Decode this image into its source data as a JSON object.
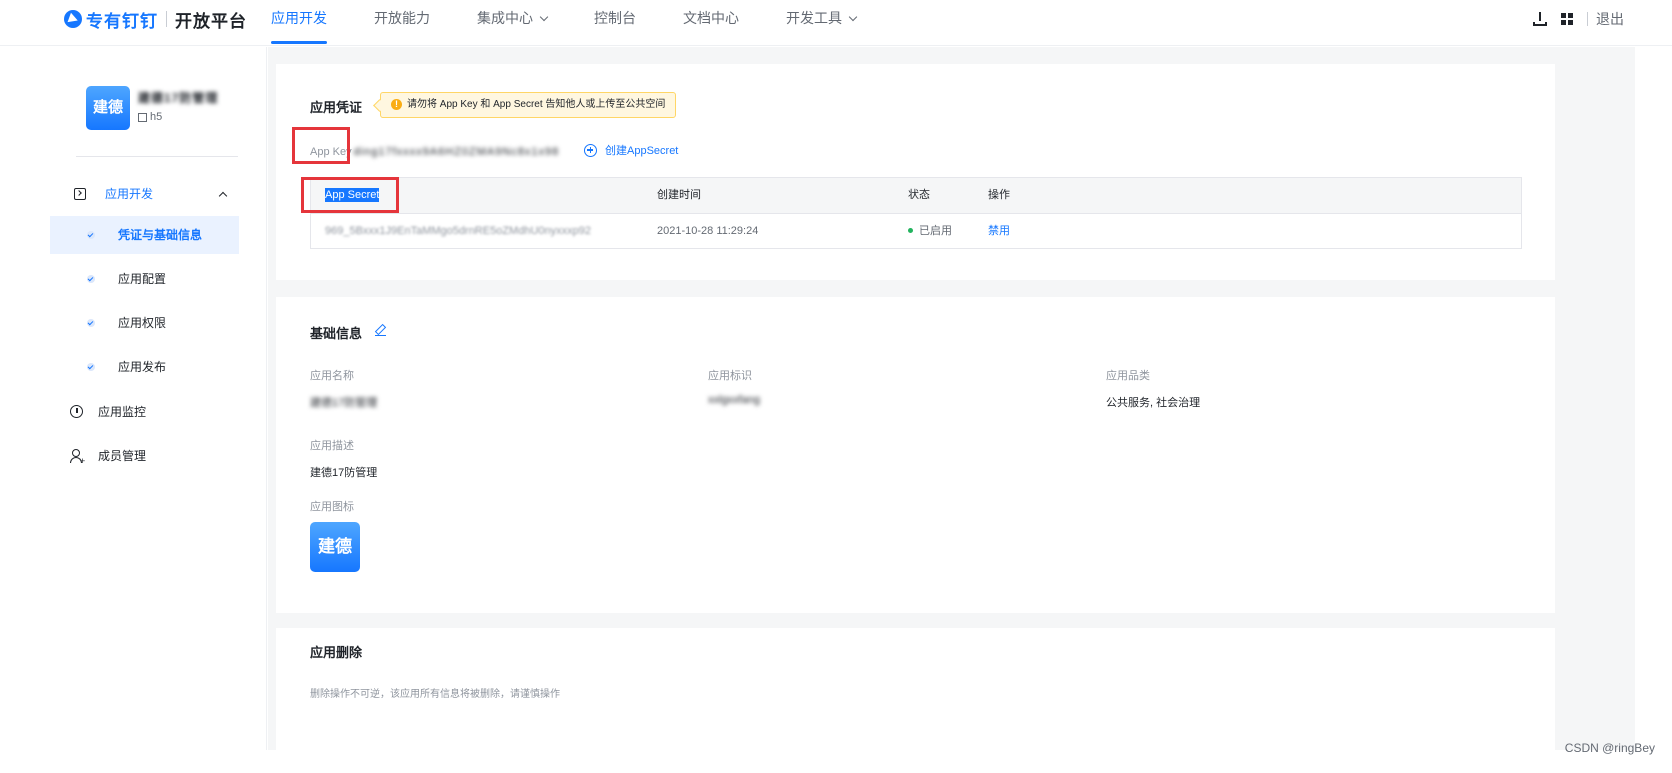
{
  "brand": {
    "name": "专有钉钉",
    "sub": "开放平台"
  },
  "nav": {
    "items": [
      {
        "label": "应用开发"
      },
      {
        "label": "开放能力"
      },
      {
        "label": "集成中心"
      },
      {
        "label": "控制台"
      },
      {
        "label": "文档中心"
      },
      {
        "label": "开发工具"
      }
    ],
    "logout": "退出"
  },
  "sidebar": {
    "app_avatar_text": "建德",
    "app_name": "建德17防管理",
    "app_type": "h5",
    "group": {
      "label": "应用开发"
    },
    "sub_items": [
      {
        "label": "凭证与基础信息"
      },
      {
        "label": "应用配置"
      },
      {
        "label": "应用权限"
      },
      {
        "label": "应用发布"
      }
    ],
    "monitor": {
      "label": "应用监控"
    },
    "members": {
      "label": "成员管理"
    }
  },
  "credentials": {
    "title": "应用凭证",
    "notice": "请勿将 App Key 和 App Secret 告知他人或上传至公共空间",
    "app_key_label": "App Key",
    "app_key_value": "ding17fxxxx9A6HZ0ZMA9Nc8x1x98",
    "create_secret": "创建AppSecret",
    "table": {
      "headers": [
        "App Secret",
        "创建时间",
        "状态",
        "操作"
      ],
      "rows": [
        {
          "secret": "969_5Bxxx1J9EnTaMMgo5drnRE5oZMdhU0nyxxxp92",
          "created": "2021-10-28 11:29:24",
          "status": "已启用",
          "action": "禁用"
        }
      ]
    }
  },
  "basic_info": {
    "title": "基础信息",
    "fields": {
      "name_label": "应用名称",
      "name_value": "建德17防管理",
      "id_label": "应用标识",
      "id_value": "xxlgxxfang",
      "category_label": "应用品类",
      "category_value": "公共服务, 社会治理",
      "desc_label": "应用描述",
      "desc_value": "建德17防管理",
      "icon_label": "应用图标",
      "icon_text": "建德"
    }
  },
  "delete_section": {
    "title": "应用删除",
    "desc": "删除操作不可逆，该应用所有信息将被删除，请谨慎操作"
  },
  "watermark": "CSDN @ringBey",
  "colors": {
    "accent": "#1677ff",
    "highlight_red": "#e5353b",
    "status_green": "#22b35e",
    "notice_bg": "#fff7e0"
  }
}
